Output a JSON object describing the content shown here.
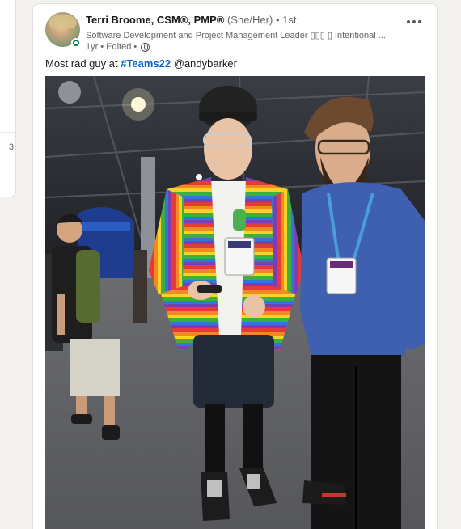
{
  "sidebar": {
    "partial_number": "3"
  },
  "post": {
    "author": {
      "name": "Terri Broome, CSM®, PMP®",
      "pronouns": "(She/Her)",
      "connection_degree": "1st",
      "headline": "Software Development and Project Management Leader  ▯▯▯  ▯  Intentional ...",
      "age": "1yr",
      "edited_label": "Edited",
      "online_status_color": "#01754f"
    },
    "text": {
      "prefix": "Most rad guy at ",
      "hashtag": "#Teams22",
      "mention": " @andybarker"
    },
    "image": {
      "description_icon": "photo"
    },
    "colors": {
      "hashtag": "#0a66c2",
      "background": "#f4f2ee"
    }
  }
}
